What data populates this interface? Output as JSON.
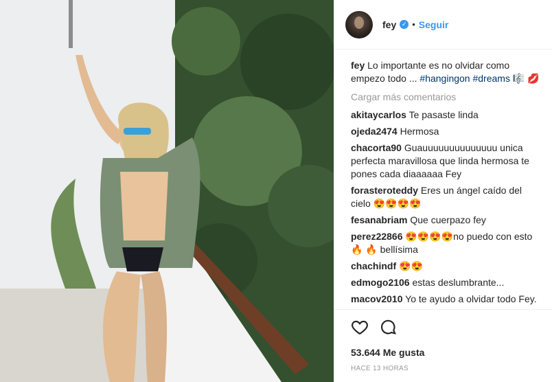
{
  "photo": {
    "alt_subject": "woman-on-balcony"
  },
  "header": {
    "username": "fey",
    "verified_mark": "✓",
    "separator": "•",
    "follow_label": "Seguir"
  },
  "caption": {
    "username": "fey",
    "text": " Lo importante es no olvidar como empezo todo ... ",
    "tags": [
      "#hangingon",
      "#dreams"
    ],
    "tail": " 🎼 💋"
  },
  "load_more": "Cargar más comentarios",
  "comments": [
    {
      "user": "akitaycarlos",
      "text": " Te pasaste linda"
    },
    {
      "user": "ojeda2474",
      "text": " Hermosa"
    },
    {
      "user": "chacorta90",
      "text": " Guauuuuuuuuuuuuuu unica perfecta maravillosa que linda hermosa te pones cada diaaaaaa Fey"
    },
    {
      "user": "forasteroteddy",
      "text": " Eres un ángel caído del cielo 😍😍😍😍"
    },
    {
      "user": "fesanabriam",
      "text": " Que cuerpazo fey"
    },
    {
      "user": "perez22866",
      "text": " 😍😍😍😍no puedo con esto 🔥 🔥 bellísima"
    },
    {
      "user": "chachindf",
      "text": " 😍😍"
    },
    {
      "user": "edmogo2106",
      "text": " estas deslumbrante..."
    },
    {
      "user": "macov2010",
      "text": " Yo te ayudo a olvidar todo Fey."
    }
  ],
  "actions": {
    "like_icon": "heart-outline",
    "comment_icon": "speech-bubble",
    "likes": "53.644 Me gusta",
    "time": "HACE 13 HORAS"
  },
  "colors": {
    "link": "#3897f0",
    "hashtag": "#003569",
    "muted": "#999999",
    "text": "#262626"
  }
}
